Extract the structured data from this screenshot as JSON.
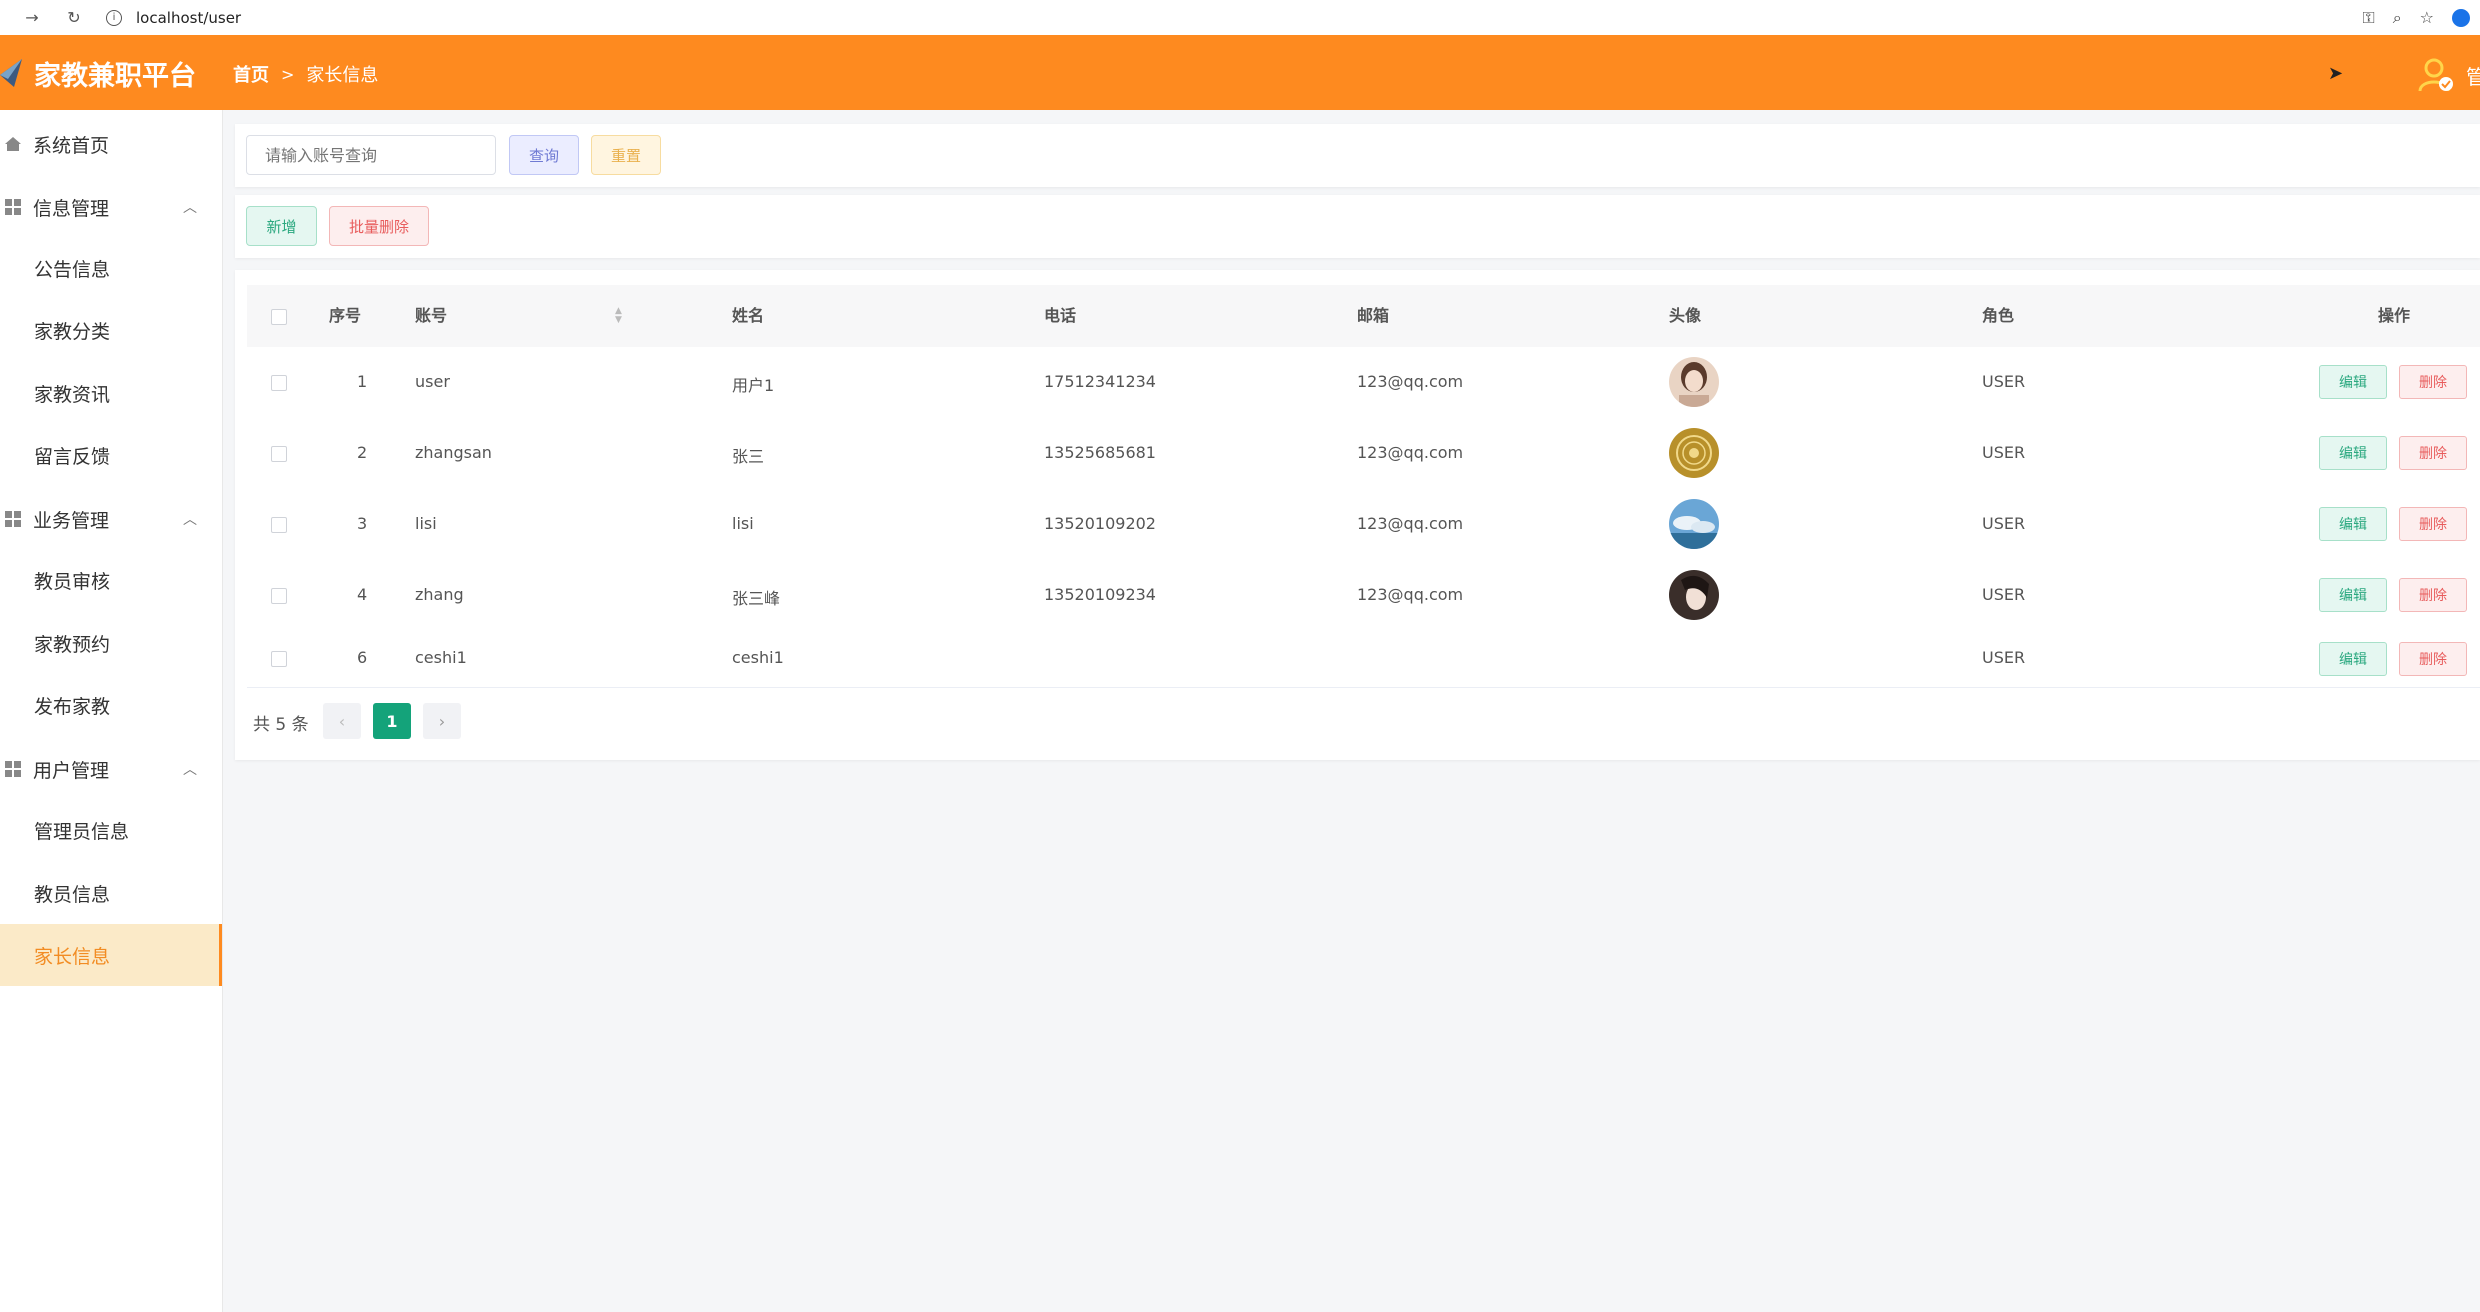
{
  "browser": {
    "url": "localhost/user"
  },
  "header": {
    "app_title": "家教兼职平台",
    "breadcrumb": [
      "首页",
      "家长信息"
    ],
    "user_name": "管",
    "brand_color": "#fe8a1f"
  },
  "sidebar": {
    "items": [
      {
        "label": "系统首页"
      },
      {
        "label": "信息管理"
      },
      {
        "label": "公告信息"
      },
      {
        "label": "家教分类"
      },
      {
        "label": "家教资讯"
      },
      {
        "label": "留言反馈"
      },
      {
        "label": "业务管理"
      },
      {
        "label": "教员审核"
      },
      {
        "label": "家教预约"
      },
      {
        "label": "发布家教"
      },
      {
        "label": "用户管理"
      },
      {
        "label": "管理员信息"
      },
      {
        "label": "教员信息"
      },
      {
        "label": "家长信息"
      }
    ]
  },
  "search": {
    "placeholder": "请输入账号查询",
    "query_label": "查询",
    "reset_label": "重置"
  },
  "toolbar": {
    "add_label": "新增",
    "batch_delete_label": "批量删除"
  },
  "table": {
    "columns": [
      "序号",
      "账号",
      "姓名",
      "电话",
      "邮箱",
      "头像",
      "角色",
      "操作"
    ],
    "rows": [
      {
        "id": "1",
        "account": "user",
        "name": "用户1",
        "phone": "17512341234",
        "email": "123@qq.com",
        "avatar": "photo-avatar",
        "role": "USER"
      },
      {
        "id": "2",
        "account": "zhangsan",
        "name": "张三",
        "phone": "13525685681",
        "email": "123@qq.com",
        "avatar": "gold-seal-avatar",
        "role": "USER"
      },
      {
        "id": "3",
        "account": "lisi",
        "name": "lisi",
        "phone": "13520109202",
        "email": "123@qq.com",
        "avatar": "sky-avatar",
        "role": "USER"
      },
      {
        "id": "4",
        "account": "zhang",
        "name": "张三峰",
        "phone": "13520109234",
        "email": "123@qq.com",
        "avatar": "photo-avatar",
        "role": "USER"
      },
      {
        "id": "6",
        "account": "ceshi1",
        "name": "ceshi1",
        "phone": "",
        "email": "",
        "avatar": "",
        "role": "USER"
      }
    ],
    "edit_label": "编辑",
    "delete_label": "删除"
  },
  "pagination": {
    "total_text": "共 5 条",
    "current_page": "1",
    "prev_icon": "‹",
    "next_icon": "›"
  }
}
